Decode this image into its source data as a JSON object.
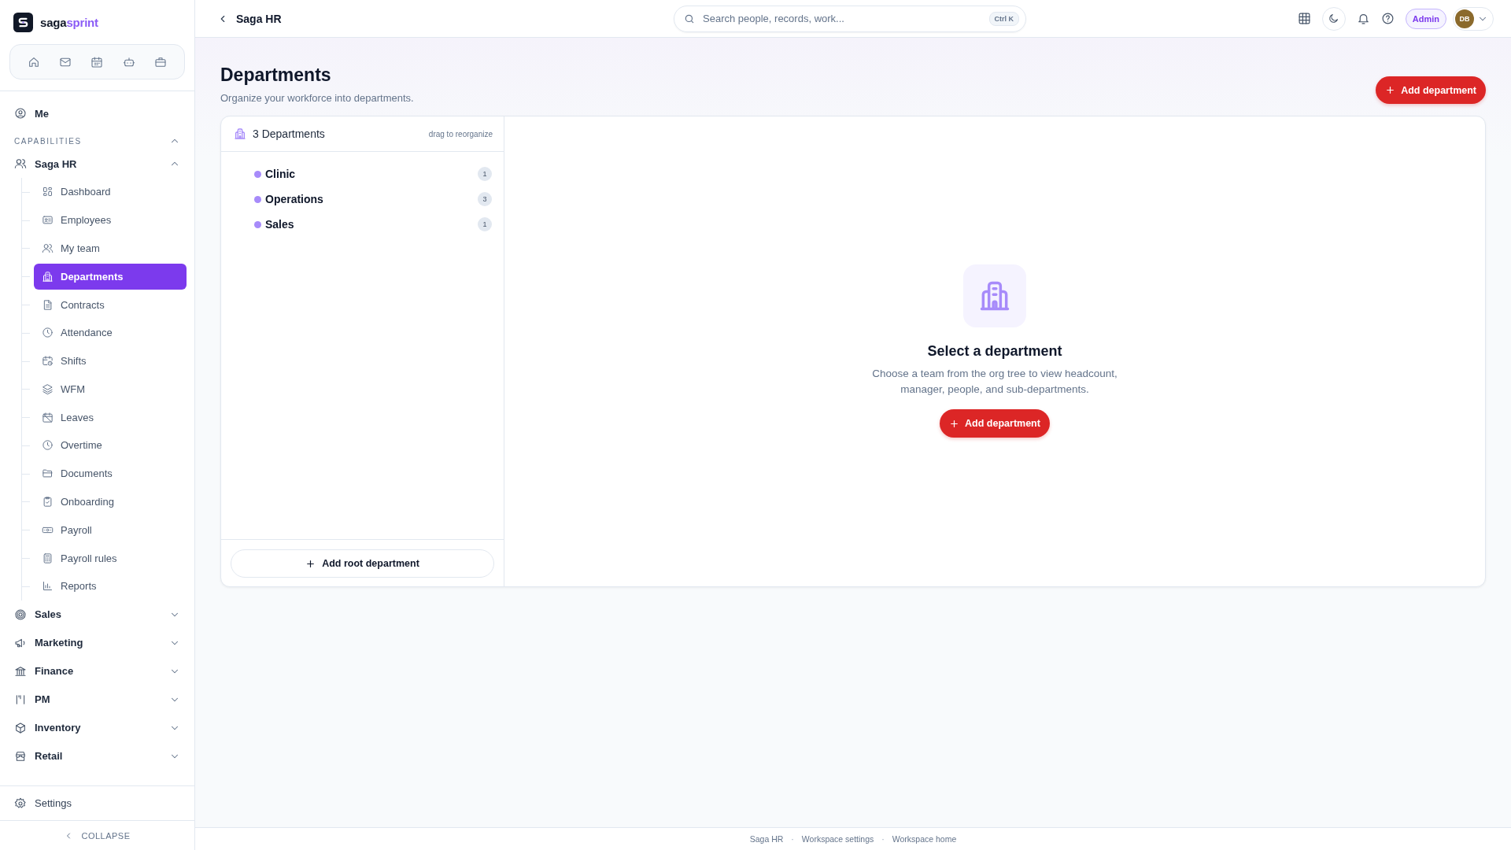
{
  "brand": {
    "name_first": "saga",
    "name_second": "sprint"
  },
  "nav": {
    "me": "Me",
    "section": {
      "label": "CAPABILITIES",
      "expanded": true
    },
    "groups": [
      {
        "label": "Saga HR",
        "expanded": true,
        "children": [
          {
            "label": "Dashboard",
            "selected": false
          },
          {
            "label": "Employees",
            "selected": false
          },
          {
            "label": "My team",
            "selected": false
          },
          {
            "label": "Departments",
            "selected": true
          },
          {
            "label": "Contracts",
            "selected": false
          },
          {
            "label": "Attendance",
            "selected": false
          },
          {
            "label": "Shifts",
            "selected": false
          },
          {
            "label": "WFM",
            "selected": false
          },
          {
            "label": "Leaves",
            "selected": false
          },
          {
            "label": "Overtime",
            "selected": false
          },
          {
            "label": "Documents",
            "selected": false
          },
          {
            "label": "Onboarding",
            "selected": false
          },
          {
            "label": "Payroll",
            "selected": false
          },
          {
            "label": "Payroll rules",
            "selected": false
          },
          {
            "label": "Reports",
            "selected": false
          }
        ]
      },
      {
        "label": "Sales",
        "expanded": false
      },
      {
        "label": "Marketing",
        "expanded": false
      },
      {
        "label": "Finance",
        "expanded": false
      },
      {
        "label": "PM",
        "expanded": false
      },
      {
        "label": "Inventory",
        "expanded": false
      },
      {
        "label": "Retail",
        "expanded": false
      }
    ],
    "settings": "Settings",
    "collapse": "COLLAPSE"
  },
  "topbar": {
    "breadcrumb": "Saga HR",
    "search": {
      "placeholder": "Search people, records, work...",
      "shortcut": "Ctrl K"
    },
    "role": "Admin",
    "avatar": "DB"
  },
  "page": {
    "title": "Departments",
    "subtitle": "Organize your workforce into departments.",
    "add_button": "Add department"
  },
  "tree_panel": {
    "count": "3 Departments",
    "hint": "drag to reorganize",
    "departments": [
      {
        "name": "Clinic",
        "count": "1"
      },
      {
        "name": "Operations",
        "count": "3"
      },
      {
        "name": "Sales",
        "count": "1"
      }
    ],
    "add_root": "Add root department"
  },
  "empty_state": {
    "title": "Select a department",
    "text": "Choose a team from the org tree to view headcount, manager, people, and sub-departments.",
    "button": "Add department"
  },
  "footer": [
    {
      "kind": "link",
      "text": "Saga HR"
    },
    {
      "kind": "separator",
      "text": "·"
    },
    {
      "kind": "link",
      "text": "Workspace settings"
    },
    {
      "kind": "separator",
      "text": "·"
    },
    {
      "kind": "link",
      "text": "Workspace home"
    }
  ]
}
